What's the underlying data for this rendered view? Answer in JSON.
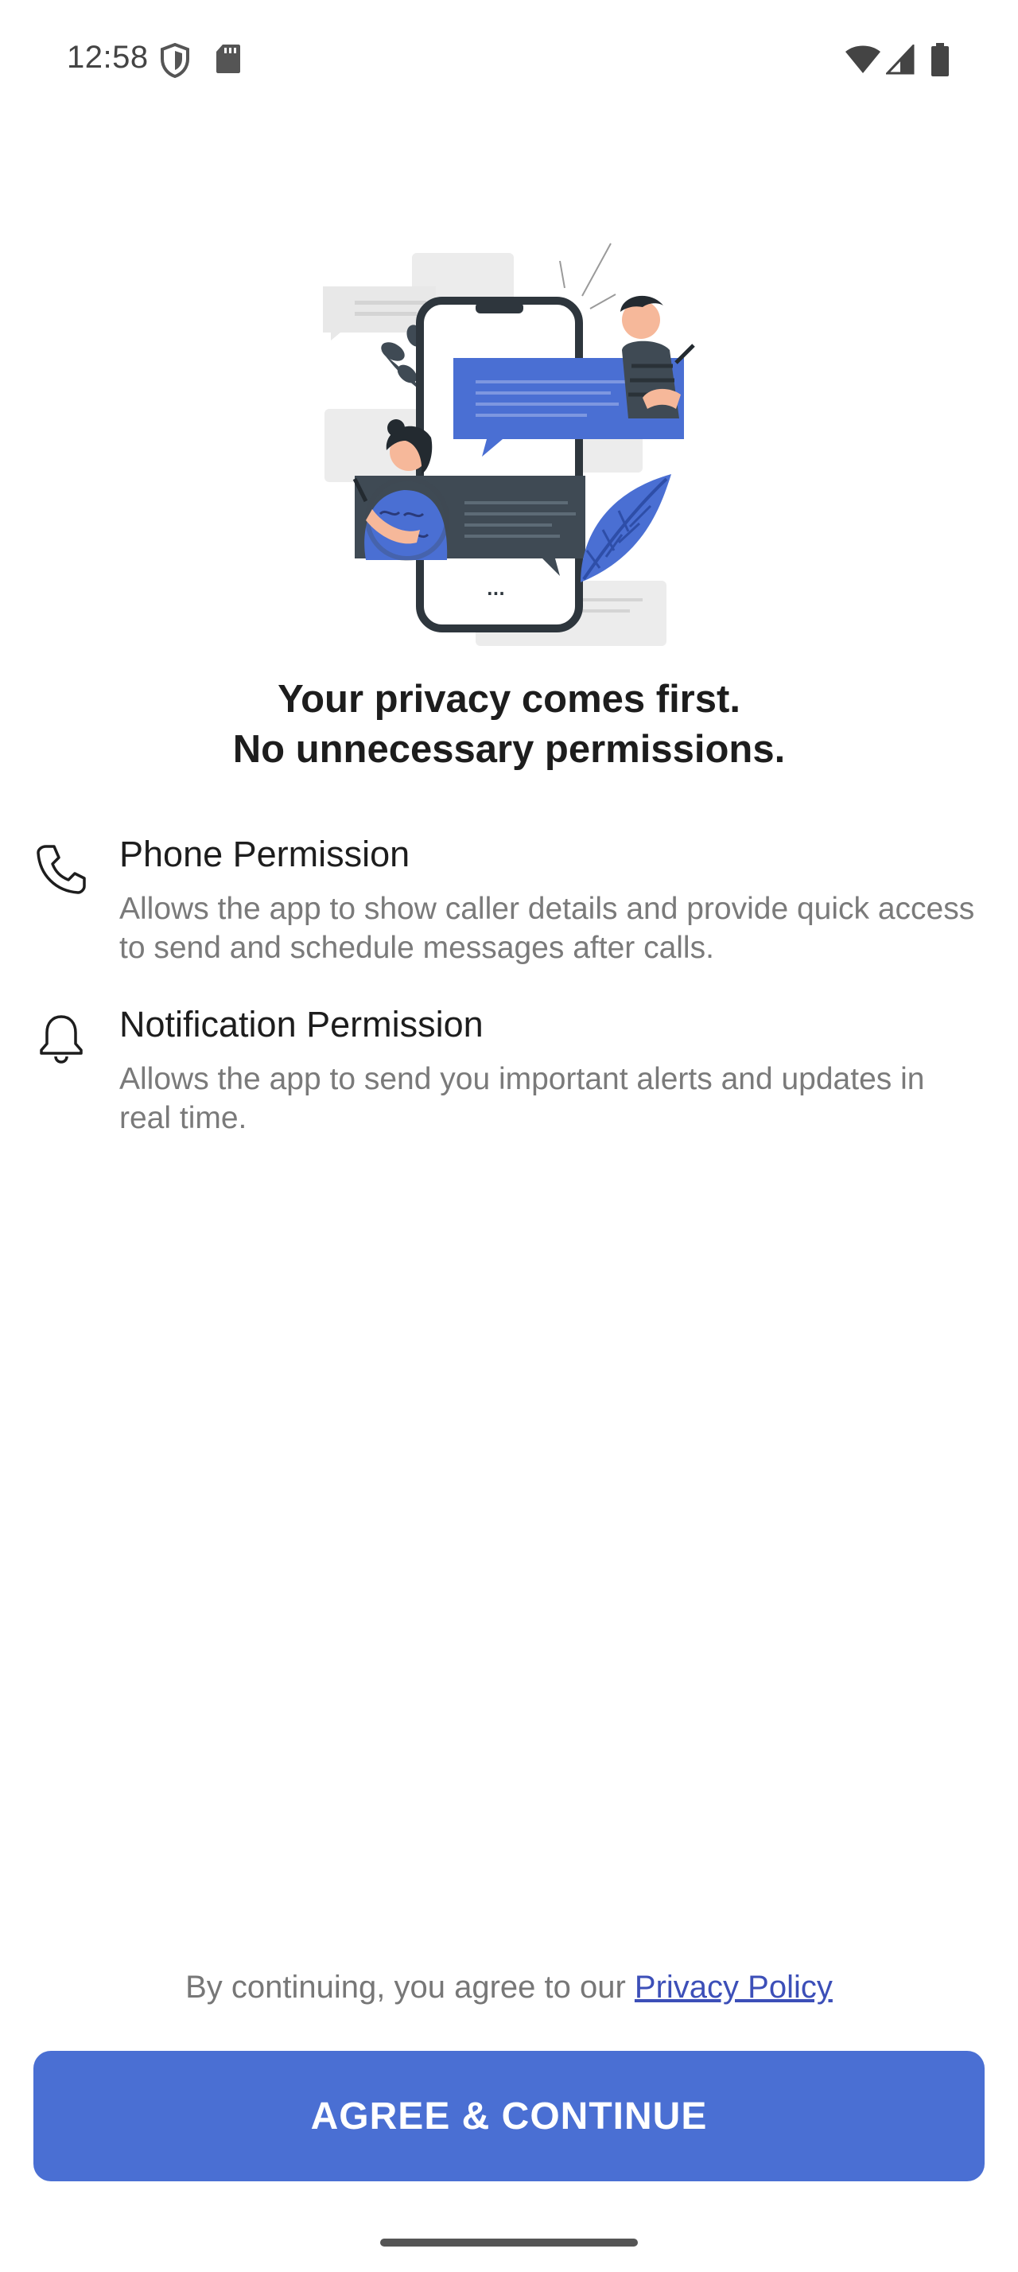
{
  "status_bar": {
    "time": "12:58",
    "icons": [
      "shield-icon",
      "sd-card-icon",
      "wifi-icon",
      "cell-signal-icon",
      "battery-icon"
    ]
  },
  "illustration": {
    "name": "chat-phone-illustration",
    "chat_dots": "..."
  },
  "headline": {
    "line1": "Your privacy comes first.",
    "line2": "No unnecessary permissions."
  },
  "permissions": [
    {
      "icon": "phone-icon",
      "title": "Phone Permission",
      "description": "Allows the app to show caller details and provide quick access to send and schedule messages after calls."
    },
    {
      "icon": "bell-icon",
      "title": "Notification Permission",
      "description": "Allows the app to send you important alerts and updates in real time."
    }
  ],
  "footer": {
    "agree_prefix": "By continuing, you agree to our ",
    "privacy_link": "Privacy Policy",
    "cta_label": "AGREE & CONTINUE"
  },
  "colors": {
    "accent": "#4a6fd3",
    "link": "#3c4fb8",
    "dark_slate": "#3f4a54",
    "body_text": "#7a7a7a"
  }
}
